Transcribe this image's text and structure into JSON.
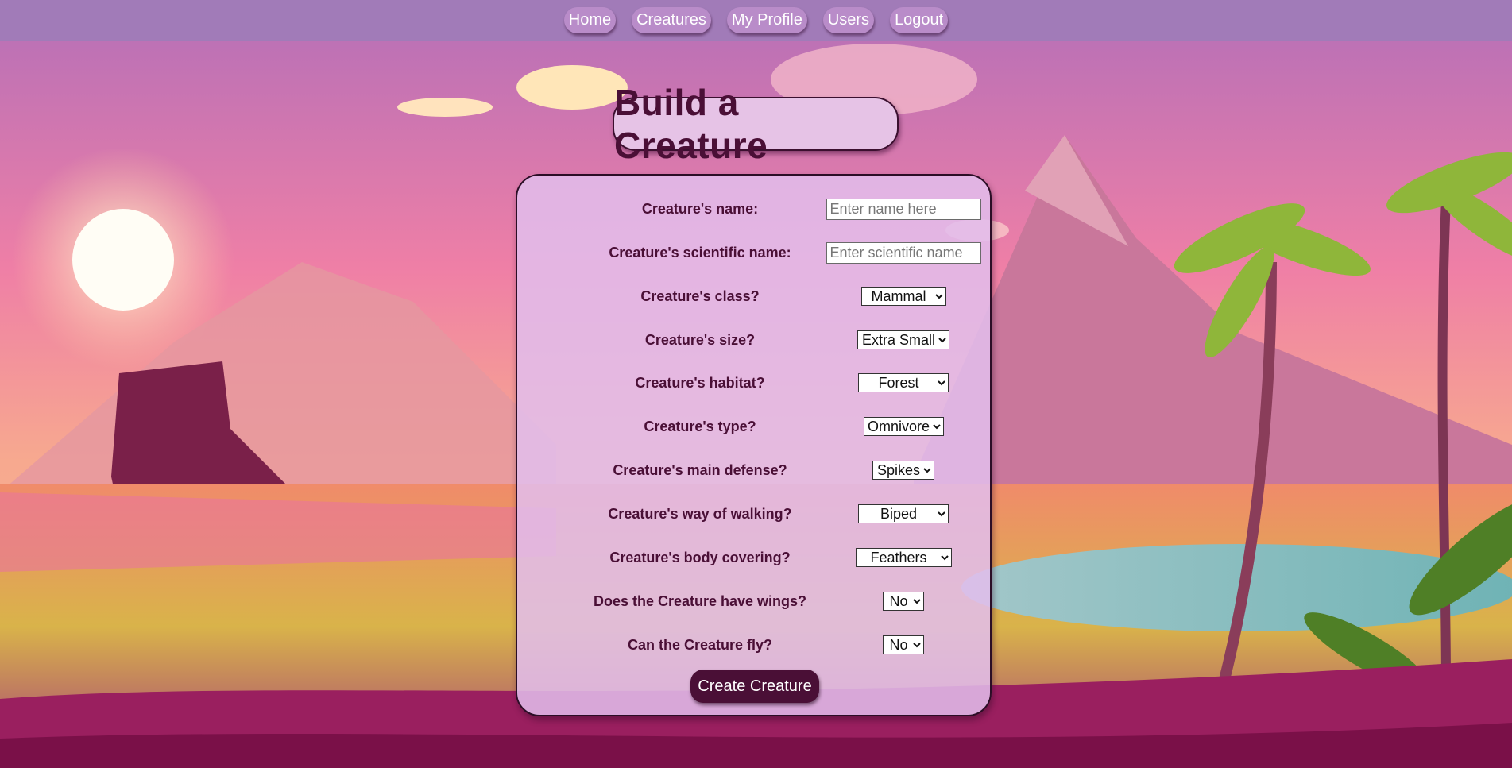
{
  "nav": {
    "items": [
      "Home",
      "Creatures",
      "My Profile",
      "Users",
      "Logout"
    ]
  },
  "page_title": "Build a Creature",
  "form": {
    "fields": [
      {
        "label": "Creature's name:",
        "type": "text",
        "placeholder": "Enter name here",
        "value": ""
      },
      {
        "label": "Creature's scientific name:",
        "type": "text",
        "placeholder": "Enter scientific name",
        "value": ""
      },
      {
        "label": "Creature's class?",
        "type": "select",
        "value": "Mammal"
      },
      {
        "label": "Creature's size?",
        "type": "select",
        "value": "Extra Small"
      },
      {
        "label": "Creature's habitat?",
        "type": "select",
        "value": "Forest"
      },
      {
        "label": "Creature's type?",
        "type": "select",
        "value": "Omnivore"
      },
      {
        "label": "Creature's main defense?",
        "type": "select",
        "value": "Spikes"
      },
      {
        "label": "Creature's way of walking?",
        "type": "select",
        "value": "Biped"
      },
      {
        "label": "Creature's body covering?",
        "type": "select",
        "value": "Feathers"
      },
      {
        "label": "Does the Creature have wings?",
        "type": "select",
        "value": "No"
      },
      {
        "label": "Can the Creature fly?",
        "type": "select",
        "value": "No"
      }
    ],
    "submit_label": "Create Creature"
  },
  "colors": {
    "nav_bg": "#a17bb8",
    "title_text": "#4a0f36",
    "panel_bg": "#e2beec",
    "button_bg": "#4a0f36"
  }
}
